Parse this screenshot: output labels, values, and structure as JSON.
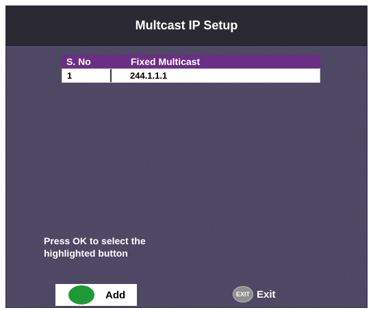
{
  "header": {
    "title": "Multcast IP Setup"
  },
  "table": {
    "columns": [
      "S. No",
      "Fixed Multicast"
    ],
    "rows": [
      {
        "sno": "1",
        "address": "244.1.1.1"
      }
    ]
  },
  "hint": {
    "line1": "Press OK to select the",
    "line2": "highlighted button"
  },
  "buttons": {
    "add": {
      "label": "Add",
      "icon": "green-button-icon"
    },
    "exit": {
      "label": "Exit",
      "icon_text": "EXIT"
    }
  },
  "colors": {
    "background": "#4d4763",
    "title_bar": "#2b2933",
    "table_header": "#6b2f86",
    "green_button": "#1f9a36"
  }
}
